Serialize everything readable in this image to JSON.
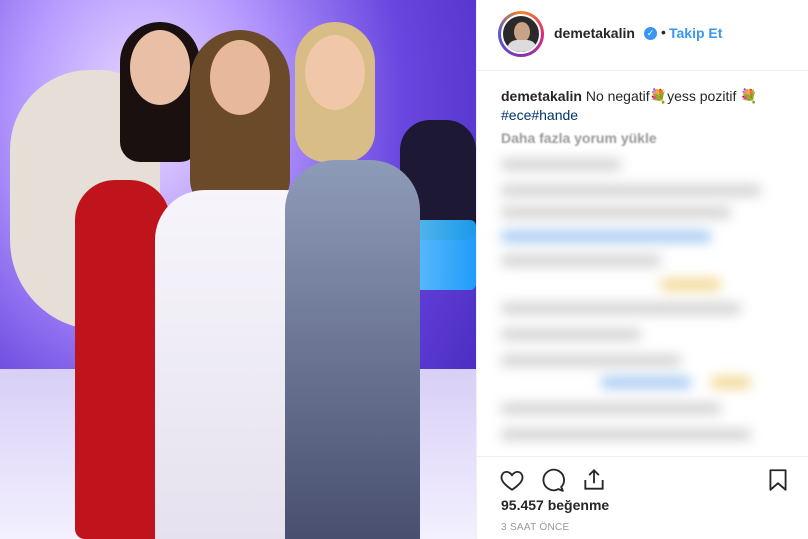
{
  "post": {
    "username": "demetakalin",
    "follow_label": "Takip Et",
    "dot": "•",
    "verified_glyph": "✓",
    "caption_user": "demetakalin",
    "caption_text": "No negatif💐yess pozitif 💐",
    "hashtags": "#ece#hande",
    "load_more": "Daha fazla yorum yükle",
    "likes": "95.457 beğenme",
    "time": "3 SAAT ÖNCE"
  },
  "icons": {
    "like": "heart-icon",
    "comment": "comment-icon",
    "share": "share-icon",
    "save": "bookmark-icon"
  },
  "colors": {
    "accent": "#3897f0",
    "hashtag": "#003569",
    "muted": "#999999"
  }
}
